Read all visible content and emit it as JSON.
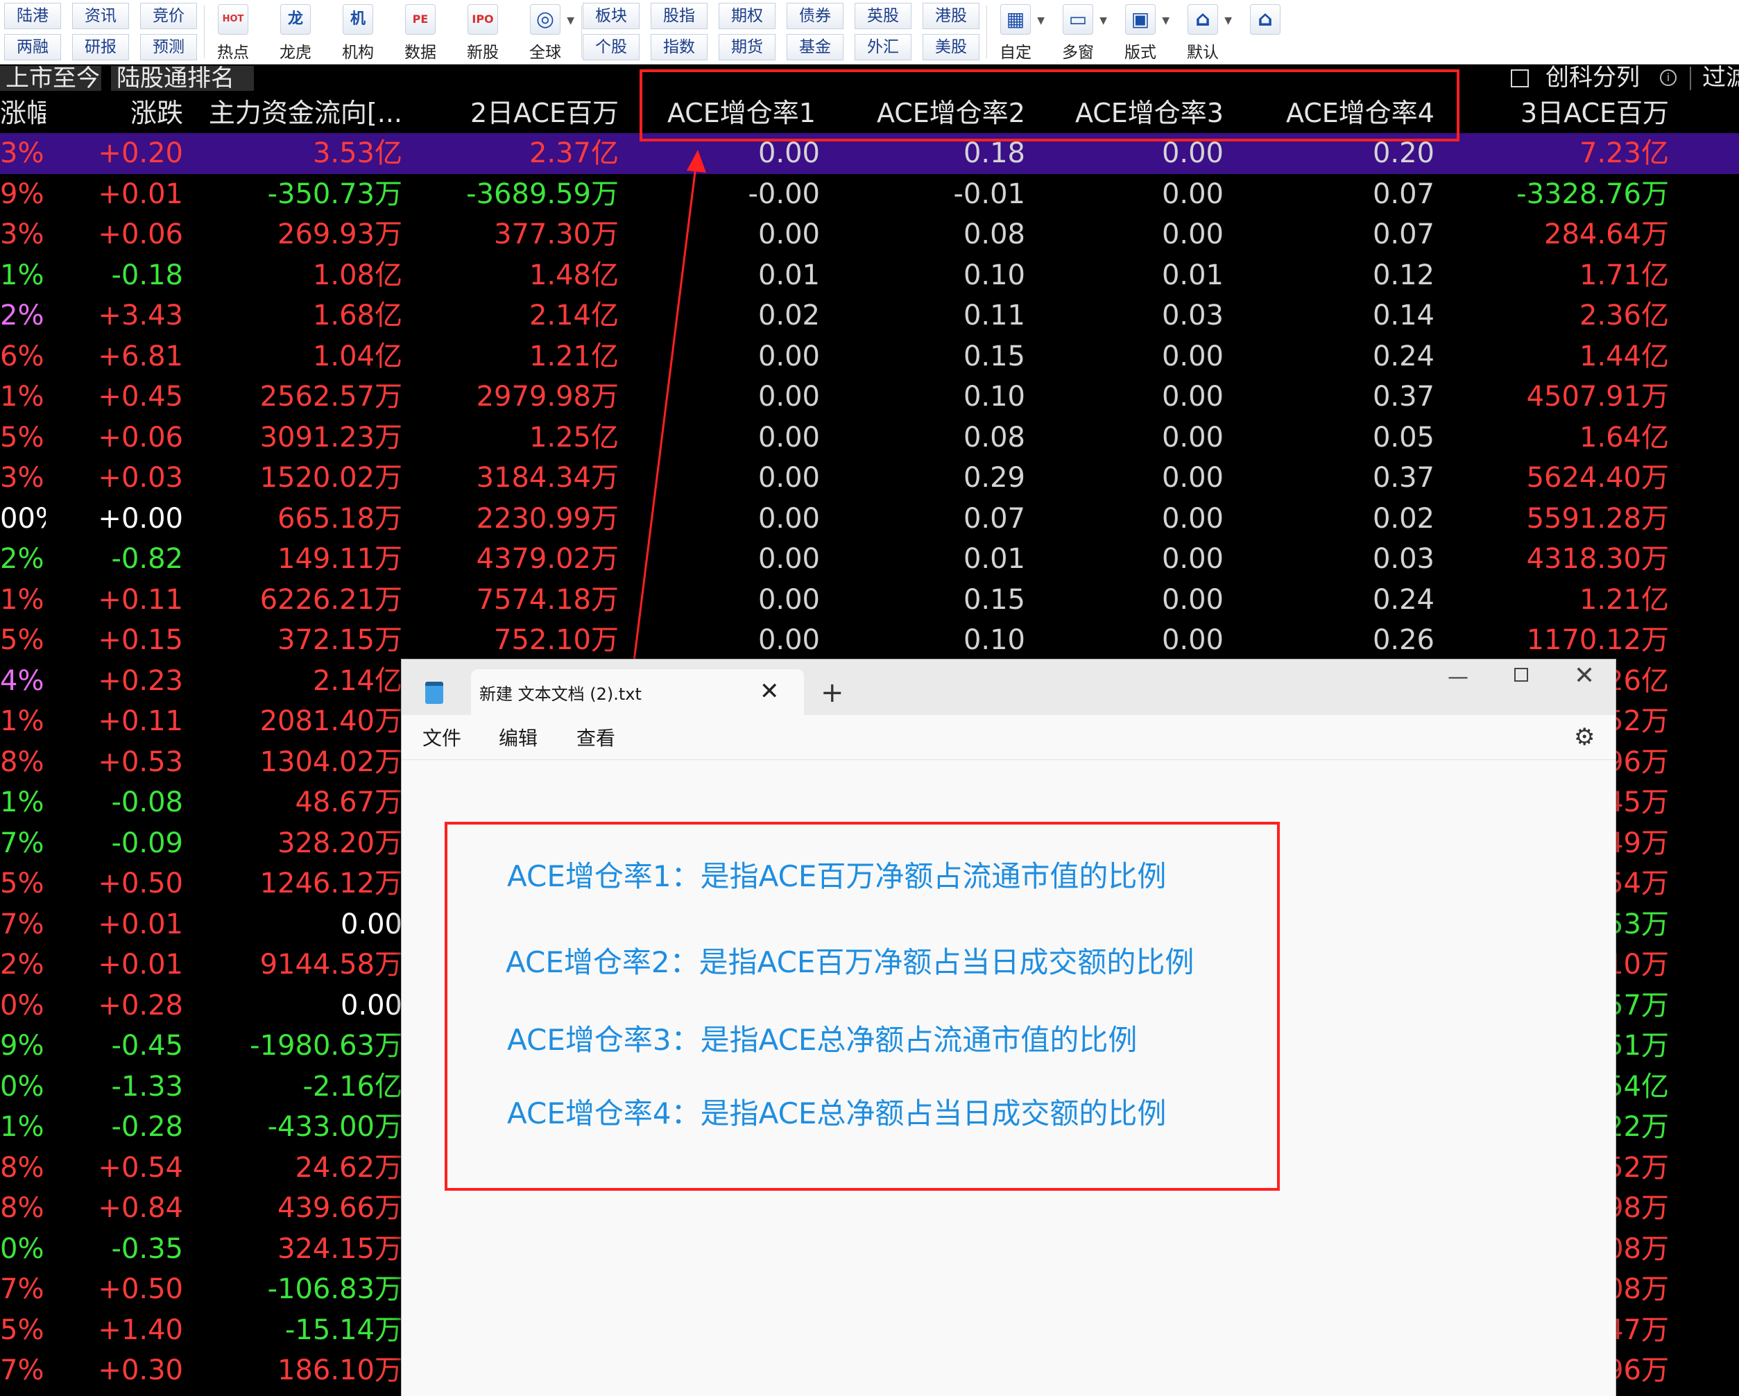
{
  "toolbar": {
    "pairs": [
      {
        "top": "陆港",
        "bottom": "两融"
      },
      {
        "top": "资讯",
        "bottom": "研报"
      },
      {
        "top": "竞价",
        "bottom": "预测"
      }
    ],
    "big1": [
      {
        "icon": "HOT",
        "label": "热点"
      },
      {
        "icon": "龙",
        "label": "龙虎"
      },
      {
        "icon": "机",
        "label": "机构"
      },
      {
        "icon": "PE",
        "label": "数据"
      },
      {
        "icon": "IPO",
        "label": "新股"
      },
      {
        "icon": "◎",
        "label": "全球"
      }
    ],
    "pairs2": [
      {
        "top": "板块",
        "bottom": "个股"
      },
      {
        "top": "股指",
        "bottom": "指数"
      },
      {
        "top": "期权",
        "bottom": "期货"
      },
      {
        "top": "债券",
        "bottom": "基金"
      },
      {
        "top": "英股",
        "bottom": "外汇"
      },
      {
        "top": "港股",
        "bottom": "美股"
      }
    ],
    "big2": [
      {
        "icon": "▦",
        "label": "自定"
      },
      {
        "icon": "▭",
        "label": "多窗"
      },
      {
        "icon": "▣",
        "label": "版式"
      },
      {
        "icon": "⌂",
        "label": "默认"
      }
    ],
    "home_icon": "⌂"
  },
  "tabs": [
    "上市至今",
    "陆股通排名"
  ],
  "options": {
    "checkbox_label": "创科分列",
    "info": "i",
    "filter_label": "过滤"
  },
  "columns": [
    "涨幅",
    "涨跌",
    "主力资金流向[...",
    "2日ACE百万",
    "ACE增仓率1",
    "ACE增仓率2",
    "ACE增仓率3",
    "ACE增仓率4",
    "3日ACE百万"
  ],
  "colors": {
    "red": "#ff3b3b",
    "green": "#3ce63c",
    "white": "#ffffff",
    "gray": "#d4d4d4",
    "magenta": "#e86ef0",
    "selected_bg": "#3a0f87",
    "highlight": "#ff2020",
    "note_text": "#1f8ee0"
  },
  "rows": [
    {
      "chg": "3%",
      "chg_c": "red",
      "diff": "+0.20",
      "diff_c": "red",
      "flow": "3.53亿",
      "flow_c": "red",
      "ace2": "2.37亿",
      "ace2_c": "red",
      "r1": "0.00",
      "r2": "0.18",
      "r3": "0.00",
      "r4": "0.20",
      "ace3": "7.23亿",
      "ace3_c": "red"
    },
    {
      "chg": "9%",
      "chg_c": "red",
      "diff": "+0.01",
      "diff_c": "red",
      "flow": "-350.73万",
      "flow_c": "green",
      "ace2": "-3689.59万",
      "ace2_c": "green",
      "r1": "-0.00",
      "r2": "-0.01",
      "r3": "0.00",
      "r4": "0.07",
      "ace3": "-3328.76万",
      "ace3_c": "green"
    },
    {
      "chg": "3%",
      "chg_c": "red",
      "diff": "+0.06",
      "diff_c": "red",
      "flow": "269.93万",
      "flow_c": "red",
      "ace2": "377.30万",
      "ace2_c": "red",
      "r1": "0.00",
      "r2": "0.08",
      "r3": "0.00",
      "r4": "0.07",
      "ace3": "284.64万",
      "ace3_c": "red"
    },
    {
      "chg": "1%",
      "chg_c": "green",
      "diff": "-0.18",
      "diff_c": "green",
      "flow": "1.08亿",
      "flow_c": "red",
      "ace2": "1.48亿",
      "ace2_c": "red",
      "r1": "0.01",
      "r2": "0.10",
      "r3": "0.01",
      "r4": "0.12",
      "ace3": "1.71亿",
      "ace3_c": "red"
    },
    {
      "chg": "2%",
      "chg_c": "magenta",
      "diff": "+3.43",
      "diff_c": "red",
      "flow": "1.68亿",
      "flow_c": "red",
      "ace2": "2.14亿",
      "ace2_c": "red",
      "r1": "0.02",
      "r2": "0.11",
      "r3": "0.03",
      "r4": "0.14",
      "ace3": "2.36亿",
      "ace3_c": "red"
    },
    {
      "chg": "6%",
      "chg_c": "red",
      "diff": "+6.81",
      "diff_c": "red",
      "flow": "1.04亿",
      "flow_c": "red",
      "ace2": "1.21亿",
      "ace2_c": "red",
      "r1": "0.00",
      "r2": "0.15",
      "r3": "0.00",
      "r4": "0.24",
      "ace3": "1.44亿",
      "ace3_c": "red"
    },
    {
      "chg": "1%",
      "chg_c": "red",
      "diff": "+0.45",
      "diff_c": "red",
      "flow": "2562.57万",
      "flow_c": "red",
      "ace2": "2979.98万",
      "ace2_c": "red",
      "r1": "0.00",
      "r2": "0.10",
      "r3": "0.00",
      "r4": "0.37",
      "ace3": "4507.91万",
      "ace3_c": "red"
    },
    {
      "chg": "5%",
      "chg_c": "red",
      "diff": "+0.06",
      "diff_c": "red",
      "flow": "3091.23万",
      "flow_c": "red",
      "ace2": "1.25亿",
      "ace2_c": "red",
      "r1": "0.00",
      "r2": "0.08",
      "r3": "0.00",
      "r4": "0.05",
      "ace3": "1.64亿",
      "ace3_c": "red"
    },
    {
      "chg": "3%",
      "chg_c": "red",
      "diff": "+0.03",
      "diff_c": "red",
      "flow": "1520.02万",
      "flow_c": "red",
      "ace2": "3184.34万",
      "ace2_c": "red",
      "r1": "0.00",
      "r2": "0.29",
      "r3": "0.00",
      "r4": "0.37",
      "ace3": "5624.40万",
      "ace3_c": "red"
    },
    {
      "chg": "00%",
      "chg_c": "white",
      "diff": "+0.00",
      "diff_c": "white",
      "flow": "665.18万",
      "flow_c": "red",
      "ace2": "2230.99万",
      "ace2_c": "red",
      "r1": "0.00",
      "r2": "0.07",
      "r3": "0.00",
      "r4": "0.02",
      "ace3": "5591.28万",
      "ace3_c": "red"
    },
    {
      "chg": "2%",
      "chg_c": "green",
      "diff": "-0.82",
      "diff_c": "green",
      "flow": "149.11万",
      "flow_c": "red",
      "ace2": "4379.02万",
      "ace2_c": "red",
      "r1": "0.00",
      "r2": "0.01",
      "r3": "0.00",
      "r4": "0.03",
      "ace3": "4318.30万",
      "ace3_c": "red"
    },
    {
      "chg": "1%",
      "chg_c": "red",
      "diff": "+0.11",
      "diff_c": "red",
      "flow": "6226.21万",
      "flow_c": "red",
      "ace2": "7574.18万",
      "ace2_c": "red",
      "r1": "0.00",
      "r2": "0.15",
      "r3": "0.00",
      "r4": "0.24",
      "ace3": "1.21亿",
      "ace3_c": "red"
    },
    {
      "chg": "5%",
      "chg_c": "red",
      "diff": "+0.15",
      "diff_c": "red",
      "flow": "372.15万",
      "flow_c": "red",
      "ace2": "752.10万",
      "ace2_c": "red",
      "r1": "0.00",
      "r2": "0.10",
      "r3": "0.00",
      "r4": "0.26",
      "ace3": "1170.12万",
      "ace3_c": "red"
    },
    {
      "chg": "4%",
      "chg_c": "magenta",
      "diff": "+0.23",
      "diff_c": "red",
      "flow": "2.14亿",
      "flow_c": "red",
      "ace2": "",
      "ace2_c": "red",
      "r1": "",
      "r2": "",
      "r3": "",
      "r4": "",
      "ace3": "26亿",
      "ace3_c": "red"
    },
    {
      "chg": "1%",
      "chg_c": "red",
      "diff": "+0.11",
      "diff_c": "red",
      "flow": "2081.40万",
      "flow_c": "red",
      "ace2": "",
      "ace2_c": "red",
      "r1": "",
      "r2": "",
      "r3": "",
      "r4": "",
      "ace3": "52万",
      "ace3_c": "red"
    },
    {
      "chg": "8%",
      "chg_c": "red",
      "diff": "+0.53",
      "diff_c": "red",
      "flow": "1304.02万",
      "flow_c": "red",
      "ace2": "",
      "ace2_c": "red",
      "r1": "",
      "r2": "",
      "r3": "",
      "r4": "",
      "ace3": "96万",
      "ace3_c": "red"
    },
    {
      "chg": "1%",
      "chg_c": "green",
      "diff": "-0.08",
      "diff_c": "green",
      "flow": "48.67万",
      "flow_c": "red",
      "ace2": "",
      "ace2_c": "red",
      "r1": "",
      "r2": "",
      "r3": "",
      "r4": "",
      "ace3": "45万",
      "ace3_c": "red"
    },
    {
      "chg": "7%",
      "chg_c": "green",
      "diff": "-0.09",
      "diff_c": "green",
      "flow": "328.20万",
      "flow_c": "red",
      "ace2": "",
      "ace2_c": "red",
      "r1": "",
      "r2": "",
      "r3": "",
      "r4": "",
      "ace3": "49万",
      "ace3_c": "red"
    },
    {
      "chg": "5%",
      "chg_c": "red",
      "diff": "+0.50",
      "diff_c": "red",
      "flow": "1246.12万",
      "flow_c": "red",
      "ace2": "",
      "ace2_c": "red",
      "r1": "",
      "r2": "",
      "r3": "",
      "r4": "",
      "ace3": "54万",
      "ace3_c": "red"
    },
    {
      "chg": "7%",
      "chg_c": "red",
      "diff": "+0.01",
      "diff_c": "red",
      "flow": "0.00",
      "flow_c": "white",
      "ace2": "",
      "ace2_c": "red",
      "r1": "",
      "r2": "",
      "r3": "",
      "r4": "",
      "ace3": "53万",
      "ace3_c": "green"
    },
    {
      "chg": "2%",
      "chg_c": "red",
      "diff": "+0.01",
      "diff_c": "red",
      "flow": "9144.58万",
      "flow_c": "red",
      "ace2": "",
      "ace2_c": "red",
      "r1": "",
      "r2": "",
      "r3": "",
      "r4": "",
      "ace3": "10万",
      "ace3_c": "red"
    },
    {
      "chg": "0%",
      "chg_c": "red",
      "diff": "+0.28",
      "diff_c": "red",
      "flow": "0.00",
      "flow_c": "white",
      "ace2": "",
      "ace2_c": "red",
      "r1": "",
      "r2": "",
      "r3": "",
      "r4": "",
      "ace3": "57万",
      "ace3_c": "green"
    },
    {
      "chg": "9%",
      "chg_c": "green",
      "diff": "-0.45",
      "diff_c": "green",
      "flow": "-1980.63万",
      "flow_c": "green",
      "ace2": "",
      "ace2_c": "red",
      "r1": "",
      "r2": "",
      "r3": "",
      "r4": "",
      "ace3": "51万",
      "ace3_c": "green"
    },
    {
      "chg": "0%",
      "chg_c": "green",
      "diff": "-1.33",
      "diff_c": "green",
      "flow": "-2.16亿",
      "flow_c": "green",
      "ace2": "",
      "ace2_c": "red",
      "r1": "",
      "r2": "",
      "r3": "",
      "r4": "",
      "ace3": "54亿",
      "ace3_c": "green"
    },
    {
      "chg": "1%",
      "chg_c": "green",
      "diff": "-0.28",
      "diff_c": "green",
      "flow": "-433.00万",
      "flow_c": "green",
      "ace2": "",
      "ace2_c": "red",
      "r1": "",
      "r2": "",
      "r3": "",
      "r4": "",
      "ace3": "22万",
      "ace3_c": "green"
    },
    {
      "chg": "8%",
      "chg_c": "red",
      "diff": "+0.54",
      "diff_c": "red",
      "flow": "24.62万",
      "flow_c": "red",
      "ace2": "",
      "ace2_c": "red",
      "r1": "",
      "r2": "",
      "r3": "",
      "r4": "",
      "ace3": "52万",
      "ace3_c": "red"
    },
    {
      "chg": "8%",
      "chg_c": "red",
      "diff": "+0.84",
      "diff_c": "red",
      "flow": "439.66万",
      "flow_c": "red",
      "ace2": "",
      "ace2_c": "red",
      "r1": "",
      "r2": "",
      "r3": "",
      "r4": "",
      "ace3": "98万",
      "ace3_c": "red"
    },
    {
      "chg": "0%",
      "chg_c": "green",
      "diff": "-0.35",
      "diff_c": "green",
      "flow": "324.15万",
      "flow_c": "red",
      "ace2": "",
      "ace2_c": "red",
      "r1": "",
      "r2": "",
      "r3": "",
      "r4": "",
      "ace3": "08万",
      "ace3_c": "red"
    },
    {
      "chg": "7%",
      "chg_c": "red",
      "diff": "+0.50",
      "diff_c": "red",
      "flow": "-106.83万",
      "flow_c": "green",
      "ace2": "",
      "ace2_c": "red",
      "r1": "",
      "r2": "",
      "r3": "",
      "r4": "",
      "ace3": "08万",
      "ace3_c": "red"
    },
    {
      "chg": "5%",
      "chg_c": "red",
      "diff": "+1.40",
      "diff_c": "red",
      "flow": "-15.14万",
      "flow_c": "green",
      "ace2": "",
      "ace2_c": "red",
      "r1": "",
      "r2": "",
      "r3": "",
      "r4": "",
      "ace3": "47万",
      "ace3_c": "red"
    },
    {
      "chg": "7%",
      "chg_c": "red",
      "diff": "+0.30",
      "diff_c": "red",
      "flow": "186.10万",
      "flow_c": "red",
      "ace2": "",
      "ace2_c": "red",
      "r1": "",
      "r2": "",
      "r3": "",
      "r4": "",
      "ace3": "96万",
      "ace3_c": "red"
    }
  ],
  "notepad": {
    "tab_title": "新建 文本文档 (2).txt",
    "close_tab": "✕",
    "new_tab": "+",
    "min": "—",
    "close": "✕",
    "menus": [
      "文件",
      "编辑",
      "查看"
    ],
    "gear": "⚙",
    "lines": [
      "ACE增仓率1：是指ACE百万净额占流通市值的比例",
      "ACE增仓率2：是指ACE百万净额占当日成交额的比例",
      "ACE增仓率3：是指ACE总净额占流通市值的比例",
      "ACE增仓率4：是指ACE总净额占当日成交额的比例"
    ]
  }
}
